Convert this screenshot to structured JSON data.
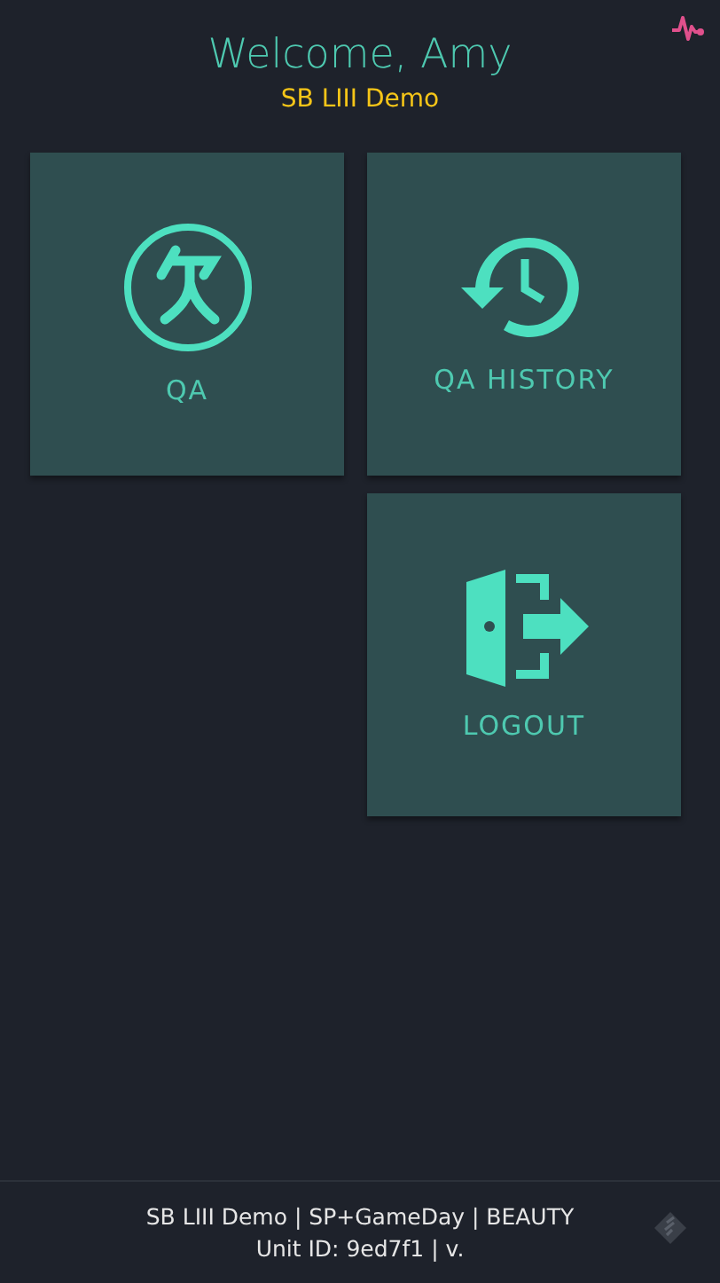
{
  "header": {
    "title": "Welcome, Amy",
    "subtitle": "SB LIII Demo"
  },
  "tiles": [
    {
      "label": "QA",
      "kind": "qa"
    },
    {
      "label": "QA HISTORY",
      "kind": "history"
    },
    {
      "label": "LOGOUT",
      "kind": "logout"
    }
  ],
  "footer": {
    "line_1": "SB LIII Demo | SP+GameDay | BEAUTY",
    "line_2": "Unit ID: 9ed7f1  | v."
  }
}
